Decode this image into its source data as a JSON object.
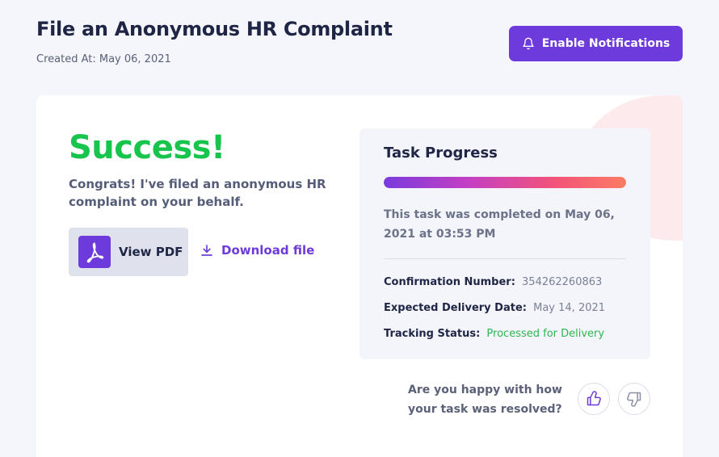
{
  "header": {
    "title": "File an Anonymous HR Complaint",
    "created_at": "Created At: May 06, 2021",
    "notifications_label": "Enable Notifications"
  },
  "result": {
    "title": "Success!",
    "message": "Congrats! I've filed an anonymous HR complaint on your behalf.",
    "view_pdf_label": "View PDF",
    "download_label": "Download file"
  },
  "progress": {
    "title": "Task Progress",
    "percent": 100,
    "completed_text": "This task was completed on May 06, 2021 at 03:53 PM",
    "fields": [
      {
        "label": "Confirmation Number:",
        "value": "354262260863"
      },
      {
        "label": "Expected Delivery Date:",
        "value": "May 14, 2021"
      },
      {
        "label": "Tracking Status:",
        "value": "Processed for Delivery"
      }
    ]
  },
  "feedback": {
    "question": "Are you happy with how your task was resolved?"
  },
  "colors": {
    "accent": "#6d3bdb",
    "success": "#17c44c",
    "status_green": "#2fb54f",
    "progress_start": "#7a3bdc",
    "progress_end": "#fb7c63"
  },
  "icons": {
    "notifications": "bell-icon",
    "pdf": "pdf-icon",
    "download": "download-icon",
    "thumbs_up": "thumbs-up-icon",
    "thumbs_down": "thumbs-down-icon"
  }
}
